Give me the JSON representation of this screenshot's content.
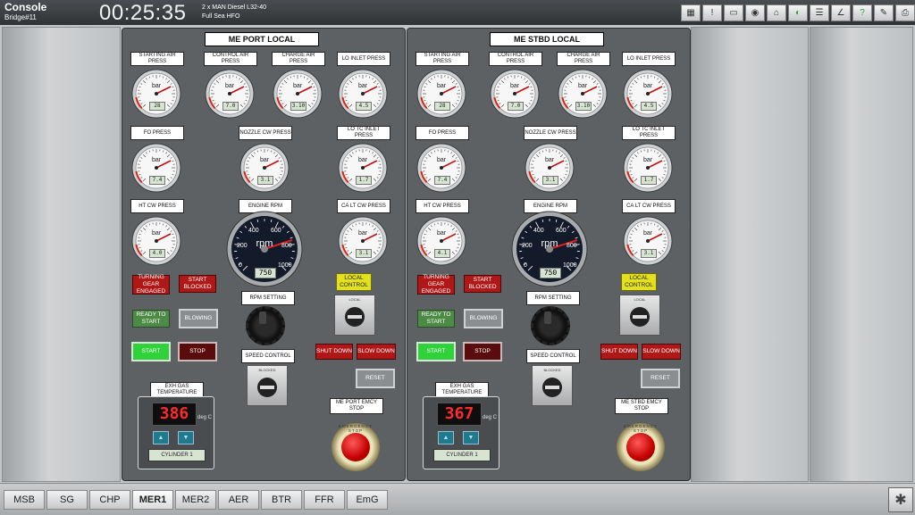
{
  "topbar": {
    "app_title": "Console",
    "bridge": "Bridge#11",
    "clock": "00:25:35",
    "engine_line1": "2 x MAN Diesel L32-40",
    "engine_line2": "Full Sea HFO",
    "toolbar_icons": [
      "ship-layout-icon",
      "alarm-list-icon",
      "monitor-icon",
      "camera-icon",
      "cctv-icon",
      "power-toggle-icon",
      "checklist-icon",
      "trend-chart-icon",
      "help-icon",
      "pen-icon",
      "print-icon",
      "fullscreen-icon"
    ]
  },
  "panels": [
    {
      "title": "ME PORT  LOCAL",
      "gauges": {
        "starting_air": {
          "label": "STARTING AIR PRESS",
          "unit": "bar",
          "value": "28"
        },
        "control_air": {
          "label": "CONTROL AIR PRESS",
          "unit": "bar",
          "value": "7.0"
        },
        "charge_air": {
          "label": "CHARGE AIR PRESS",
          "unit": "bar",
          "value": "3.10"
        },
        "lo_inlet": {
          "label": "LO INLET PRESS",
          "unit": "bar",
          "value": "4.5"
        },
        "fo": {
          "label": "FO PRESS",
          "unit": "bar",
          "value": "7.4"
        },
        "nozzle_cw": {
          "label": "NOZZLE CW PRESS",
          "unit": "bar",
          "value": "3.1"
        },
        "lo_tc_inlet": {
          "label": "LO TC INLET PRESS",
          "unit": "bar",
          "value": "1.7"
        },
        "ht_cw": {
          "label": "HT CW PRESS",
          "unit": "bar",
          "value": "4.0"
        },
        "ca_lt_cw": {
          "label": "CA LT CW PRESS",
          "unit": "bar",
          "value": "3.1"
        }
      },
      "rpm": {
        "label": "ENGINE RPM",
        "unit": "rpm",
        "value": "750",
        "ticks": [
          "0",
          "200",
          "400",
          "600",
          "800",
          "1000"
        ]
      },
      "turning_gear": "TURNING GEAR ENGAGED",
      "start_blocked": "START BLOCKED",
      "ready_to_start": "READY TO START",
      "blowing": "BLOWING",
      "start": "START",
      "stop": "STOP",
      "rpm_setting": "RPM SETTING",
      "speed_control": "SPEED CONTROL",
      "speed_sel_label": "BLOCKED",
      "local_control": "LOCAL CONTROL",
      "local_sel_label": "LOCAL",
      "shut_down": "SHUT DOWN",
      "slow_down": "SLOW DOWN",
      "reset": "RESET",
      "exh_label": "EXH GAS TEMPERATURE",
      "exh_value": "386",
      "exh_unit": "deg C",
      "cylinder": "CYLINDER 1",
      "emcy_label": "ME PORT EMCY STOP",
      "emcy_ring": "EMERGENCY STOP"
    },
    {
      "title": "ME STBD  LOCAL",
      "gauges": {
        "starting_air": {
          "label": "STARTING AIR PRESS",
          "unit": "bar",
          "value": "28"
        },
        "control_air": {
          "label": "CONTROL AIR PRESS",
          "unit": "bar",
          "value": "7.0"
        },
        "charge_air": {
          "label": "CHARGE AIR PRESS",
          "unit": "bar",
          "value": "3.10"
        },
        "lo_inlet": {
          "label": "LO INLET PRESS",
          "unit": "bar",
          "value": "4.5"
        },
        "fo": {
          "label": "FO PRESS",
          "unit": "bar",
          "value": "7.4"
        },
        "nozzle_cw": {
          "label": "NOZZLE CW PRESS",
          "unit": "bar",
          "value": "3.1"
        },
        "lo_tc_inlet": {
          "label": "LO TC INLET PRESS",
          "unit": "bar",
          "value": "1.7"
        },
        "ht_cw": {
          "label": "HT CW PRESS",
          "unit": "bar",
          "value": "4.1"
        },
        "ca_lt_cw": {
          "label": "CA LT CW PRESS",
          "unit": "bar",
          "value": "3.1"
        }
      },
      "rpm": {
        "label": "ENGINE RPM",
        "unit": "rpm",
        "value": "750",
        "ticks": [
          "0",
          "200",
          "400",
          "600",
          "800",
          "1000"
        ]
      },
      "turning_gear": "TURNING GEAR ENGAGED",
      "start_blocked": "START BLOCKED",
      "ready_to_start": "READY TO START",
      "blowing": "BLOWING",
      "start": "START",
      "stop": "STOP",
      "rpm_setting": "RPM SETTING",
      "speed_control": "SPEED CONTROL",
      "speed_sel_label": "BLOCKED",
      "local_control": "LOCAL CONTROL",
      "local_sel_label": "LOCAL",
      "shut_down": "SHUT DOWN",
      "slow_down": "SLOW DOWN",
      "reset": "RESET",
      "exh_label": "EXH GAS TEMPERATURE",
      "exh_value": "367",
      "exh_unit": "deg C",
      "cylinder": "CYLINDER 1",
      "emcy_label": "ME STBD EMCY STOP",
      "emcy_ring": "EMERGENCY STOP"
    }
  ],
  "bottom_tabs": [
    "MSB",
    "SG",
    "CHP",
    "MER1",
    "MER2",
    "AER",
    "BTR",
    "FFR",
    "EmG"
  ],
  "active_tab": "MER1",
  "colors": {
    "panel": "#5e6163",
    "alarm_red": "#b01818",
    "ready_green": "#2fd23a",
    "local_yellow": "#e3e01e"
  }
}
